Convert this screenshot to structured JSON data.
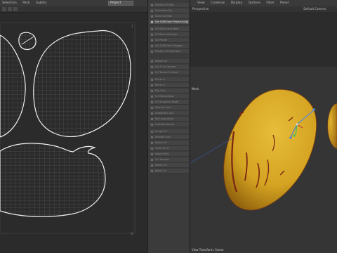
{
  "uv_editor": {
    "menu": [
      "Selection",
      "Pack",
      "Subdiv"
    ],
    "context_dropdown": "Project"
  },
  "command_panel": {
    "items": [
      {
        "label": "Frontal UV Map"
      },
      {
        "label": "Normalize Tex"
      },
      {
        "label": "Clear UV Map"
      },
      {
        "label": "Set UVW from Projection",
        "active": true
      },
      {
        "label": "UV Stitch and Weld"
      },
      {
        "label": "UV Relax Settings"
      },
      {
        "label": "UV Packer"
      },
      {
        "label": "Set UVW from Polygon"
      },
      {
        "label": "Realign UV Selection"
      },
      {
        "label": "Rotate UV"
      },
      {
        "label": "Fit UV to Canvas"
      },
      {
        "label": "UV Terrain Context"
      },
      {
        "label": "Mirror U"
      },
      {
        "label": "Mirror V"
      },
      {
        "label": "Flip UVs"
      },
      {
        "label": "UV Manipulator"
      },
      {
        "label": "UV Snapping Mode"
      },
      {
        "label": "Align to Grid"
      },
      {
        "label": "Straighten UVs"
      },
      {
        "label": "Rectangularize"
      },
      {
        "label": "Unwrap Islands"
      },
      {
        "label": "Image Fill"
      },
      {
        "label": "Smooth UVs"
      },
      {
        "label": "Match UV"
      },
      {
        "label": "Scale to Fit"
      },
      {
        "label": "Island Pack"
      },
      {
        "label": "UV Transfer"
      },
      {
        "label": "Select UV"
      },
      {
        "label": "Reset UV"
      }
    ]
  },
  "viewport": {
    "menu": [
      "View",
      "Cameras",
      "Display",
      "Options",
      "Filter",
      "Panel"
    ],
    "view_label": "Perspective",
    "camera_label": "Default Camera",
    "mesh_label": "Mesh",
    "status_text": "View Transform: Scene",
    "colors": {
      "fruit": "#d4a321",
      "fruit_shadow": "#a97a10",
      "stripes": "#7a2412"
    }
  }
}
